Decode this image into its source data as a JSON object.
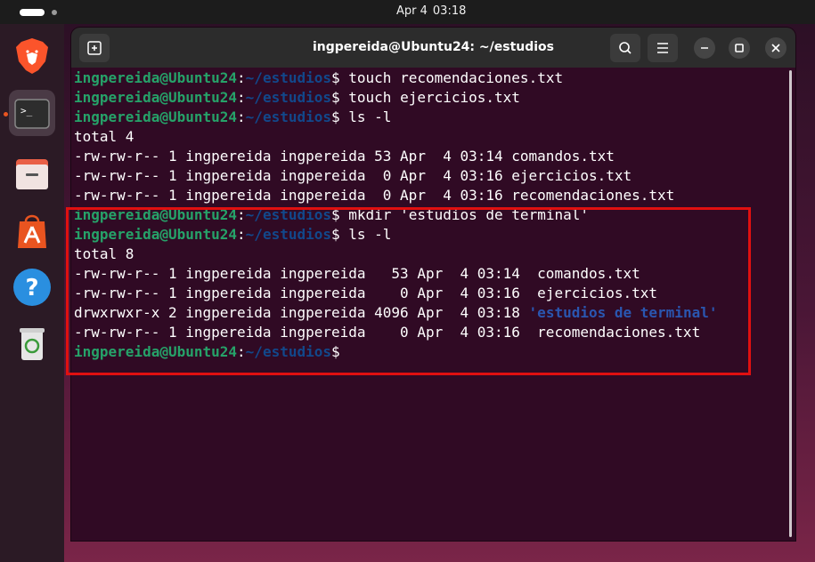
{
  "clock": {
    "date": "Apr 4",
    "time": "03:18"
  },
  "window": {
    "title": "ingpereida@Ubuntu24: ~/estudios"
  },
  "dock": {
    "items": [
      {
        "name": "brave-browser"
      },
      {
        "name": "terminal"
      },
      {
        "name": "files"
      },
      {
        "name": "app-center"
      },
      {
        "name": "help"
      },
      {
        "name": "trash"
      }
    ]
  },
  "terminal": {
    "user": "ingpereida@Ubuntu24",
    "path": "~/estudios",
    "lines": [
      {
        "type": "prompt",
        "cmd": " touch recomendaciones.txt"
      },
      {
        "type": "prompt",
        "cmd": " touch ejercicios.txt"
      },
      {
        "type": "prompt",
        "cmd": " ls -l"
      },
      {
        "type": "out",
        "text": "total 4"
      },
      {
        "type": "out",
        "text": "-rw-rw-r-- 1 ingpereida ingpereida 53 Apr  4 03:14 comandos.txt"
      },
      {
        "type": "out",
        "text": "-rw-rw-r-- 1 ingpereida ingpereida  0 Apr  4 03:16 ejercicios.txt"
      },
      {
        "type": "out",
        "text": "-rw-rw-r-- 1 ingpereida ingpereida  0 Apr  4 03:16 recomendaciones.txt"
      },
      {
        "type": "prompt",
        "cmd": " mkdir 'estudios de terminal'"
      },
      {
        "type": "prompt",
        "cmd": " ls -l"
      },
      {
        "type": "out",
        "text": "total 8"
      },
      {
        "type": "out",
        "text": "-rw-rw-r-- 1 ingpereida ingpereida   53 Apr  4 03:14  comandos.txt"
      },
      {
        "type": "out",
        "text": "-rw-rw-r-- 1 ingpereida ingpereida    0 Apr  4 03:16  ejercicios.txt"
      },
      {
        "type": "dir",
        "text": "drwxrwxr-x 2 ingpereida ingpereida 4096 Apr  4 03:18 ",
        "dir": "'estudios de terminal'"
      },
      {
        "type": "out",
        "text": "-rw-rw-r-- 1 ingpereida ingpereida    0 Apr  4 03:16  recomendaciones.txt"
      },
      {
        "type": "prompt",
        "cmd": ""
      }
    ]
  },
  "colors": {
    "terminal_bg": "#300a24",
    "user_green": "#26a269",
    "path_blue": "#12488b",
    "highlight_red": "#e01010"
  }
}
